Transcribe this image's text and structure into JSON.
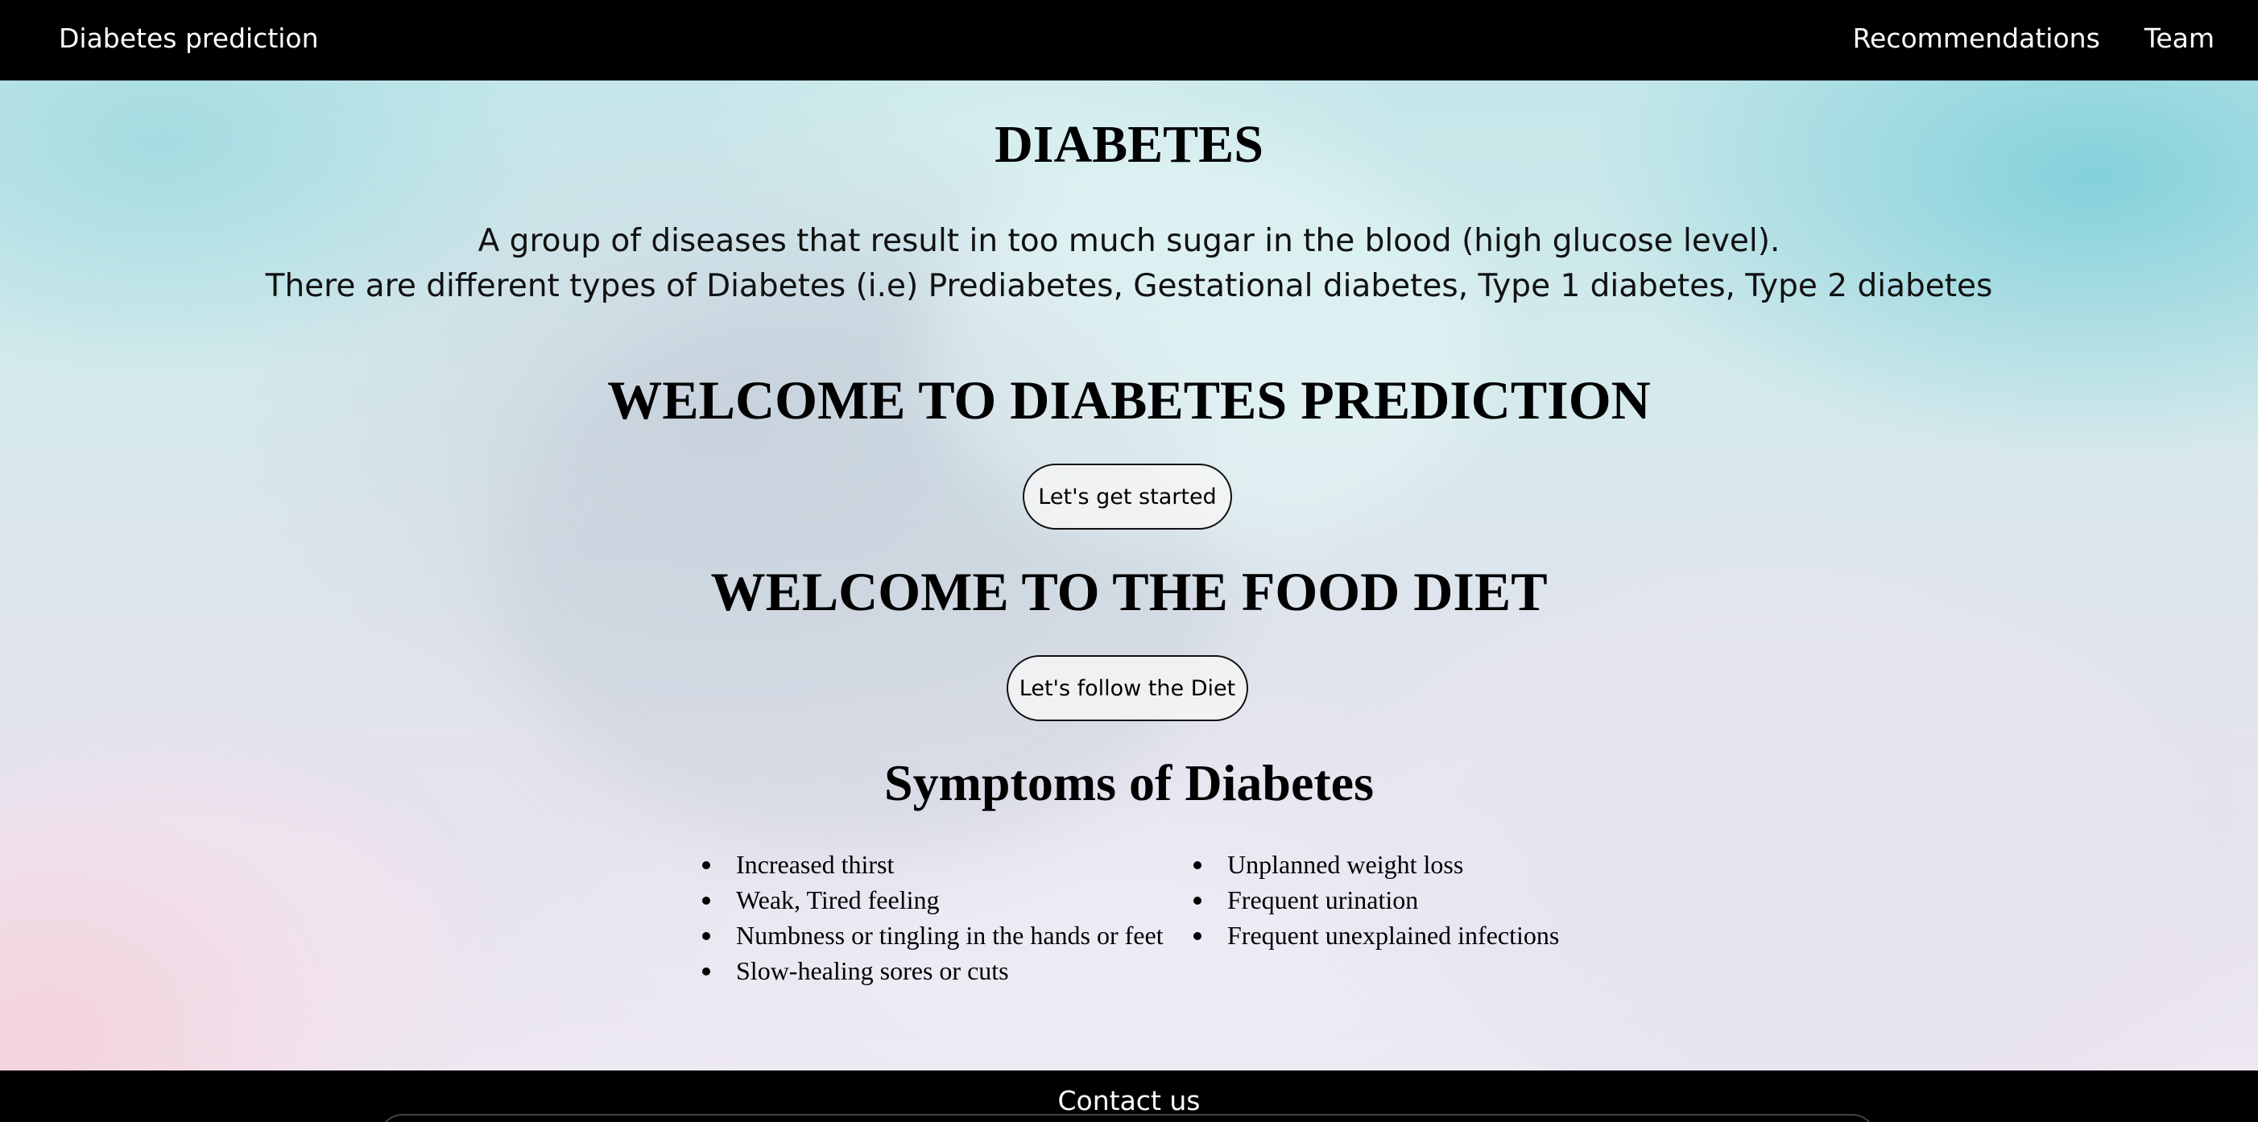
{
  "navbar": {
    "brand": "Diabetes prediction",
    "links": [
      {
        "label": "Recommendations"
      },
      {
        "label": "Team"
      }
    ]
  },
  "hero": {
    "title": "DIABETES",
    "intro_lines": [
      "A group of diseases that result in too much sugar in the blood (high glucose level).",
      "There are different types of Diabetes (i.e) Prediabetes, Gestational diabetes, Type 1 diabetes, Type 2 diabetes"
    ],
    "prediction_heading": "WELCOME TO DIABETES PREDICTION",
    "prediction_button": "Let's get started",
    "diet_heading": "WELCOME TO THE FOOD DIET",
    "diet_button": "Let's follow the Diet"
  },
  "symptoms": {
    "heading": "Symptoms of Diabetes",
    "left": [
      "Increased thirst",
      "Weak, Tired feeling",
      "Numbness or tingling in the hands or feet",
      "Slow-healing sores or cuts"
    ],
    "right": [
      "Unplanned weight loss",
      "Frequent urination",
      "Frequent unexplained infections"
    ]
  },
  "footer": {
    "contact": "Contact us"
  }
}
